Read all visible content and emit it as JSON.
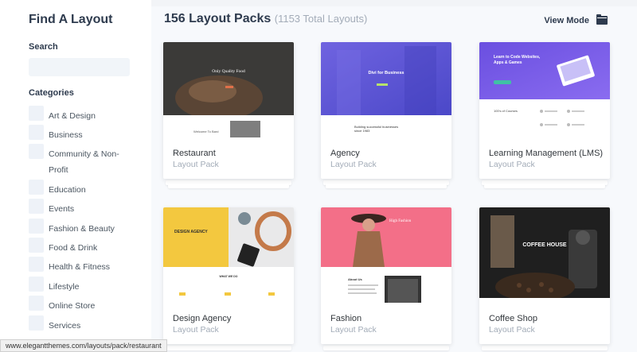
{
  "sidebar": {
    "title": "Find A Layout",
    "search_label": "Search",
    "search_placeholder": "",
    "categories_label": "Categories",
    "categories": [
      {
        "label": "Art & Design"
      },
      {
        "label": "Business"
      },
      {
        "label": "Community & Non-Profit"
      },
      {
        "label": "Education"
      },
      {
        "label": "Events"
      },
      {
        "label": "Fashion & Beauty"
      },
      {
        "label": "Food & Drink"
      },
      {
        "label": "Health & Fitness"
      },
      {
        "label": "Lifestyle"
      },
      {
        "label": "Online Store"
      },
      {
        "label": "Services"
      }
    ]
  },
  "main": {
    "title": "156 Layout Packs",
    "subtitle": "(1153 Total Layouts)",
    "view_mode_label": "View Mode",
    "view_mode_icon": "folder-icon",
    "packs": [
      {
        "name": "Restaurant",
        "kind": "Layout Pack",
        "hero_text": "Only Quality Food",
        "body_text": "Welcome To Bard"
      },
      {
        "name": "Agency",
        "kind": "Layout Pack",
        "hero_text": "Divi for Business",
        "body_text": "Building successful businesses since 1983"
      },
      {
        "name": "Learning Management (LMS)",
        "kind": "Layout Pack",
        "hero_text": "Learn to Code Websites, Apps & Games",
        "body_text": "100's of Courses"
      },
      {
        "name": "Design Agency",
        "kind": "Layout Pack",
        "hero_text": "DESIGN AGENCY",
        "body_text": "WHAT WE DO"
      },
      {
        "name": "Fashion",
        "kind": "Layout Pack",
        "hero_text": "High Fashion",
        "body_text": "About Us"
      },
      {
        "name": "Coffee Shop",
        "kind": "Layout Pack",
        "hero_text": "COFFEE HOUSE",
        "body_text": ""
      }
    ]
  },
  "status_url": "www.elegantthemes.com/layouts/pack/restaurant",
  "colors": {
    "agency_purple": "#6a5bd6",
    "lms_purple": "#7b5be6",
    "design_yellow": "#f3c83f",
    "fashion_pink": "#f06d86",
    "coffee_dark": "#1f1f1f",
    "restaurant_dark": "#3b3a38"
  }
}
